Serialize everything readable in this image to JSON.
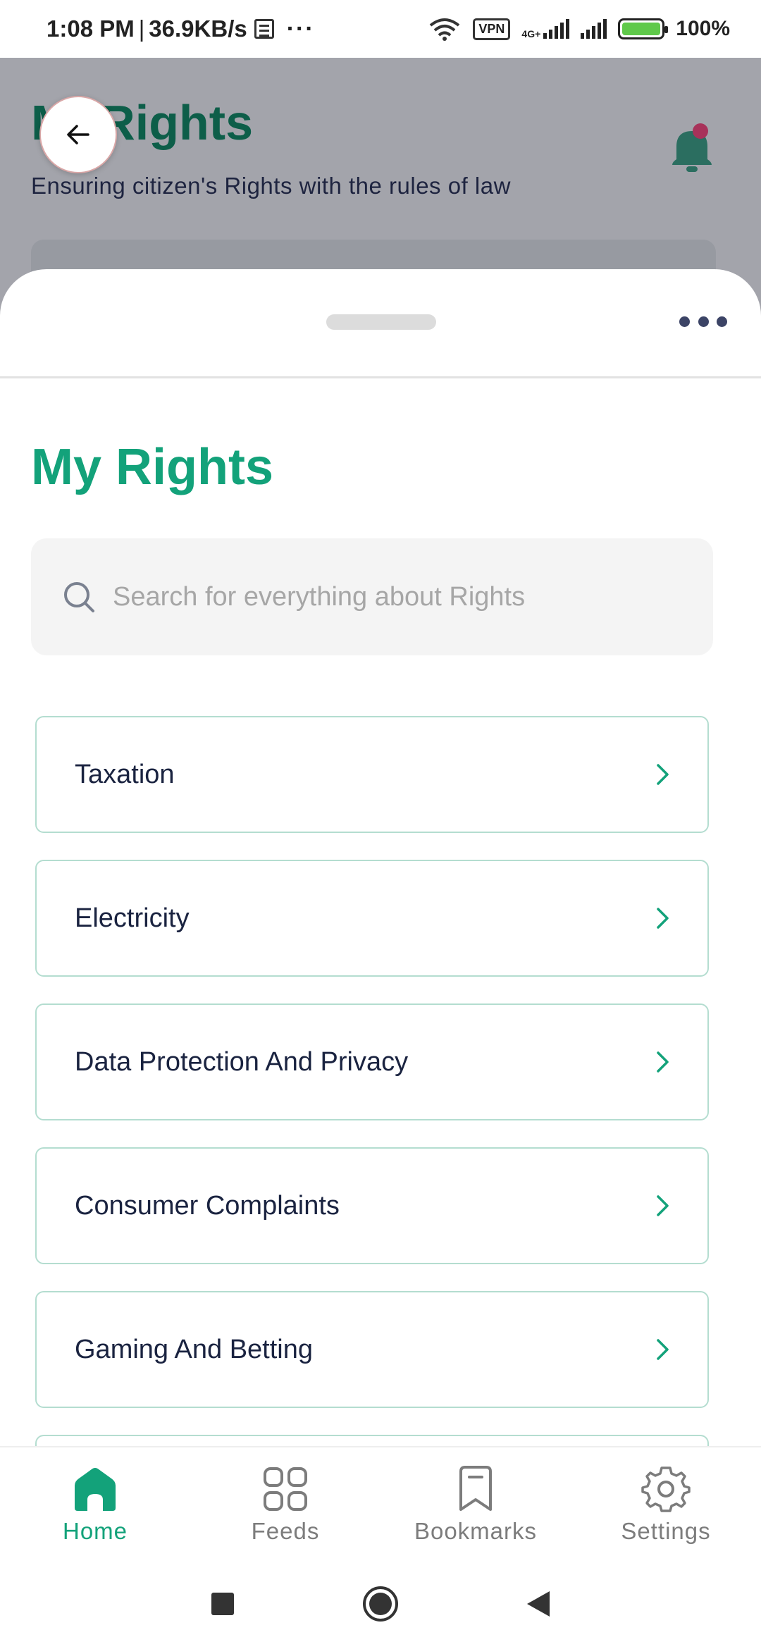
{
  "status_bar": {
    "time": "1:08 PM",
    "separator": "|",
    "speed": "36.9KB/s",
    "more": "···",
    "vpn": "VPN",
    "network": "4G+",
    "battery": "100%"
  },
  "background_app": {
    "title": "MyRights",
    "subtitle": "Ensuring citizen's Rights with the rules of law"
  },
  "sheet": {
    "heading": "My Rights",
    "search_placeholder": "Search for everything about Rights",
    "items": [
      {
        "label": "Taxation"
      },
      {
        "label": "Electricity"
      },
      {
        "label": "Data Protection And Privacy"
      },
      {
        "label": "Consumer Complaints"
      },
      {
        "label": "Gaming And Betting"
      }
    ]
  },
  "bottom_nav": {
    "items": [
      {
        "label": "Home",
        "icon": "home-icon",
        "active": true
      },
      {
        "label": "Feeds",
        "icon": "grid-icon",
        "active": false
      },
      {
        "label": "Bookmarks",
        "icon": "bookmark-icon",
        "active": false
      },
      {
        "label": "Settings",
        "icon": "gear-icon",
        "active": false
      }
    ]
  },
  "colors": {
    "accent": "#13a27a",
    "text": "#1a2340",
    "border": "#b4ddd0",
    "notification": "#a8325a"
  }
}
